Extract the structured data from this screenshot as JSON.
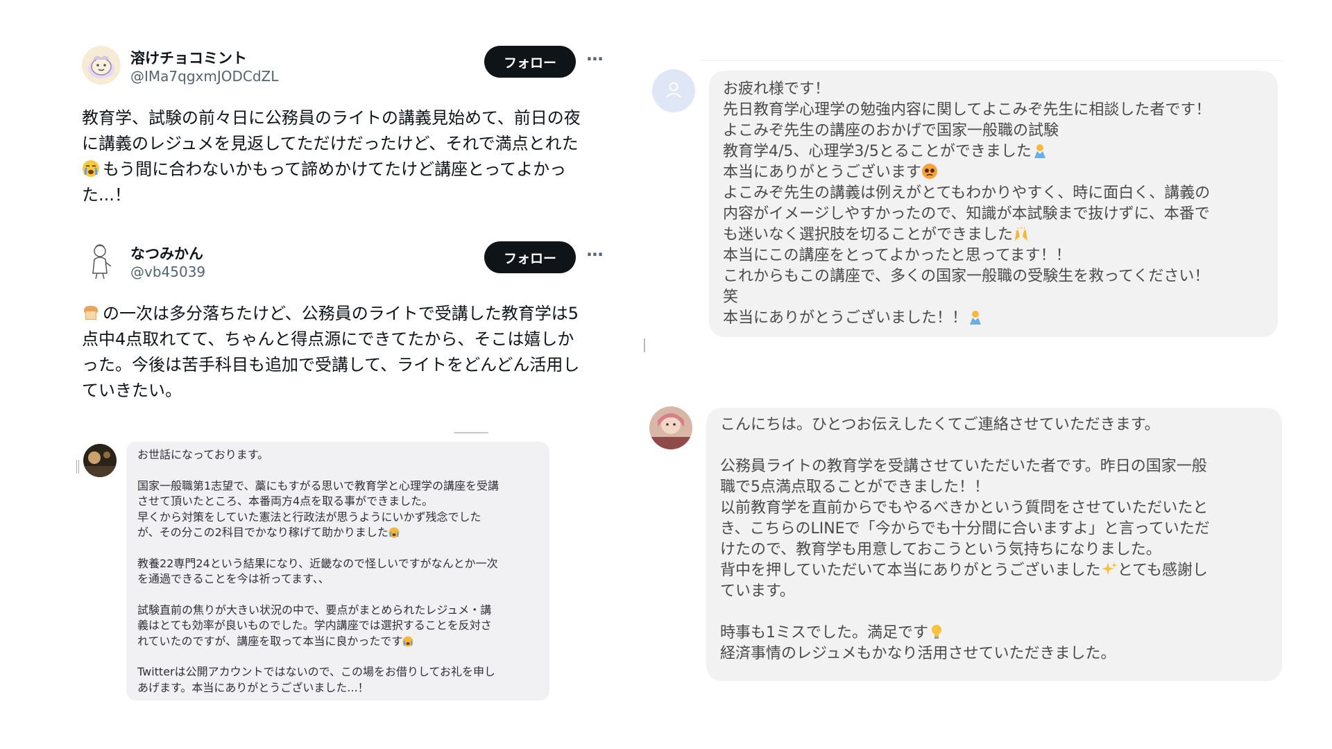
{
  "posts": [
    {
      "author_name": "溶けチョコミント",
      "author_handle": "@IMa7qgxmJODCdZL",
      "follow_label": "フォロー",
      "more_label": "···",
      "body_lines": [
        "教育学、試験の前々日に公務員のライトの講義見始めて、前日の夜",
        "に講義のレジュメを見返してただけだったけど、それで満点とれた",
        "もう間に合わないかもって諦めかけてたけど講座とってよかっ",
        "た...！"
      ]
    },
    {
      "author_name": "なつみかん",
      "author_handle": "@vb45039",
      "follow_label": "フォロー",
      "more_label": "···",
      "body_lines": [
        "の一次は多分落ちたけど、公務員のライトで受講した教育学は5",
        "点中4点取れてて、ちゃんと得点源にできてたから、そこは嬉しか",
        "った。今後は苦手科目も追加で受講して、ライトをどんどん活用し",
        "ていきたい。"
      ]
    }
  ],
  "message_left": {
    "paragraphs": [
      [
        "お世話になっております。"
      ],
      [
        "国家一般職第1志望で、藁にもすがる思いで教育学と心理学の講座を受講",
        "させて頂いたところ、本番両方4点を取る事ができました。",
        "早くから対策をしていた憲法と行政法が思うようにいかず残念でした",
        "が、その分この2科目でかなり稼げて助かりました"
      ],
      [
        "教養22専門24という結果になり、近畿なので怪しいですがなんとか一次",
        "を通過できることを今は祈ってます、、"
      ],
      [
        "試験直前の焦りが大きい状況の中で、要点がまとめられたレジュメ・講",
        "義はとても効率が良いものでした。学内講座では選択することを反対さ",
        "れていたのですが、講座を取って本当に良かったです"
      ],
      [
        "Twitterは公開アカウントではないので、この場をお借りしてお礼を申し",
        "あげます。本当にありがとうございました...！"
      ]
    ]
  },
  "message_right_1": {
    "lines": [
      "お疲れ様です！",
      "先日教育学心理学の勉強内容に関してよこみぞ先生に相談した者です！",
      "よこみぞ先生の講座のおかげで国家一般職の試験",
      "教育学4/5、心理学3/5とることができました",
      "本当にありがとうございます",
      "よこみぞ先生の講義は例えがとてもわかりやすく、時に面白く、講義の",
      "内容がイメージしやすかったので、知識が本試験まで抜けずに、本番で",
      "も迷いなく選択肢を切ることができました",
      "本当にこの講座をとってよかったと思ってます！！",
      "これからもこの講座で、多くの国家一般職の受験生を救ってください！",
      "笑",
      "本当にありがとうございました！！"
    ]
  },
  "message_right_2": {
    "lines": [
      "こんにちは。ひとつお伝えしたくてご連絡させていただきます。",
      "",
      "公務員ライトの教育学を受講させていただいた者です。昨日の国家一般",
      "職で5点満点取ることができました！！",
      "以前教育学を直前からでもやるべきかという質問をさせていただいたと",
      "き、こちらのLINEで「今からでも十分間に合いますよ」と言っていただ",
      "けたので、教育学も用意しておこうという気持ちになりました。",
      "背中を押していただいて本当にありがとうございました",
      "とても感謝し",
      "ています。",
      "",
      "時事も1ミスでした。満足です",
      "経済事情のレジュメもかなり活用させていただきました。"
    ]
  },
  "icons": [
    "crying-face-icon",
    "bread-icon",
    "praying-hands-icon",
    "pleading-face-icon",
    "raised-hands-icon",
    "sparkles-icon",
    "light-bulb-icon",
    "user-placeholder-icon"
  ]
}
